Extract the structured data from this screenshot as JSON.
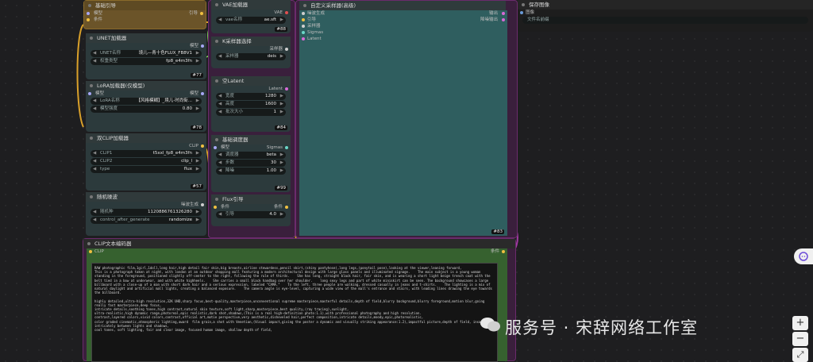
{
  "colors": {
    "port_green": "#7bd35a",
    "port_yellow": "#f0c040",
    "port_orange": "#f08040",
    "port_red": "#e05050",
    "port_blue": "#6a9ad8",
    "port_pink": "#d86ad8",
    "link_yellow": "#d9a02a",
    "link_purple": "#a13aa3"
  },
  "node_basic_guide": {
    "title": "基础引导",
    "in_label": "模型",
    "in_label2": "条件",
    "out_label": "引导"
  },
  "node_unet": {
    "title": "UNET加载器",
    "out_label": "模型",
    "name_k": "UNET名称",
    "name_v": "境儿—青十色FLUX_FB8V1",
    "dtype_k": "权重类型",
    "dtype_v": "fp8_e4m3fn",
    "badge": "#77"
  },
  "node_lora": {
    "title": "LoRA加载器(仅模型)",
    "in_label": "模型",
    "out_label": "模型",
    "name_k": "LoRA名称",
    "name_v": "【风格模糊】_境儿-时尚街...",
    "strength_k": "模型强度",
    "strength_v": "0.80",
    "badge": "#78"
  },
  "node_dualclip": {
    "title": "双CLIP加载器",
    "out_label": "CLIP",
    "clip1_k": "CLIP1",
    "clip1_v": "t5xxl_fp8_e4m3fn",
    "clip2_k": "CLIP2",
    "clip2_v": "clip_l",
    "type_k": "type",
    "type_v": "flux",
    "badge": "#57"
  },
  "node_noise": {
    "title": "随机噪波",
    "out_label": "噪波生成",
    "seed_k": "随机种",
    "seed_v": "1120886761326280",
    "ctrl_k": "control_after_generate",
    "ctrl_v": "randomize"
  },
  "node_vae": {
    "title": "VAE加载器",
    "out_label": "VAE",
    "name_k": "vae名称",
    "name_v": "ae.sft",
    "badge": "#88"
  },
  "node_ksampler_select": {
    "title": "K采样器选择",
    "out_label": "采样器",
    "name_k": "采样器",
    "name_v": "deis"
  },
  "node_latent": {
    "title": "空Latent",
    "out_label": "Latent",
    "w_k": "宽度",
    "w_v": "1280",
    "h_k": "高度",
    "h_v": "1600",
    "b_k": "批次大小",
    "b_v": "1",
    "badge": "#84"
  },
  "node_scheduler": {
    "title": "基础调度器",
    "in_label": "模型",
    "out_label": "Sigmas",
    "s_k": "调度器",
    "s_v": "beta",
    "st_k": "步数",
    "st_v": "30",
    "d_k": "降噪",
    "d_v": "1.00",
    "badge": "#99"
  },
  "node_flux_guide": {
    "title": "Flux引导",
    "in_label": "条件",
    "out_label": "条件",
    "g_k": "引导",
    "g_v": "4.0"
  },
  "node_custom_sampler": {
    "title": "自定义采样器(高级)",
    "inputs": [
      "噪波生成",
      "引导",
      "采样器",
      "Sigmas",
      "Latent"
    ],
    "out1": "输出",
    "out2": "降噪输出",
    "badge": "#83"
  },
  "node_save": {
    "title": "保存图像",
    "in_label": "图像",
    "prefix": "文件名前缀"
  },
  "node_clip_text": {
    "title": "CLIP文本编码器",
    "in_label": "CLIP",
    "out_label": "条件",
    "prompt": "RAW photographic film,1girl,1doll,long hair,high detail fair skin,big breasts,airline stewardess,pencil skirt,(shiny pantyhose),long legs,(ponytail pose),looking at the viewer,leaning forward,\nThis is a photograph taken at night, with london at an outdoor shopping mall featuring a modern architectural design with large glass panels and illuminated signage.    The main subject is a young woman standing in the foreground, positioned slightly off-center to the right, following the rule of thirds.    She has long, straight black hair, fair skin, and is wearing a short light beige trench coat with the belt tied in a bow at underwear, and with white highheels.    She carries a small black handbag over her shoulder.    long sexy legs and part of white miniskirt can be seen. The background showcases a large billboard with a close-up of a man with short dark hair and a serious expression, labeled \"CAMA.\"    To the left, three people are walking, dressed casually in jeans and t-shirts.    The lighting is a mix of natural daylight and artificial mall lights, creating a balanced exposure.    The camera angle is eye-level, capturing a wide view of the mall's entrance and stairs, with leading lines drawing the eye towards the billboard.\n\nhighly detailed,ultra-high resolution,32K UHD,sharp focus,best-quality,masterpiece,unconventional supreme masterpiece,masterful details,depth of field,blurry background,blurry foreground,motion blur,going really fast masterpiece,deep focus,\nintricate details,soothing tones,high contrast,natural skin texture,soft light,sharp,masterpiece,best quality,(ray tracing),sunlight,\nultra-realistic,high dynamic range,photoreal,epic realistic,dark shot,shadows,(This is a real high-definition photo:1.1),with professional photography and high resolution.\ncontrast,layered colors,vivid colors,contrast,official art,motie perspective,very aesthetic,disheveled hair,perfect composition,intricate details,moody,epic,photorealistic,\ncolor graded cinematic,atmospheric lighting,award  film grain,a shot with Venetian,(Visual impact,giving the poster a dynamic and visually striking appearance:1.2),impactful picture,depth of field, insanely intricately between lights and shadows,\ncool tones, soft lighting, fair and clear image, focused human image, shallow depth of field,"
  },
  "watermark": "服务号 · 宋辞网络工作室",
  "side_buttons": {
    "zoom_in": "+",
    "zoom_out": "−",
    "fit": "⤢"
  }
}
